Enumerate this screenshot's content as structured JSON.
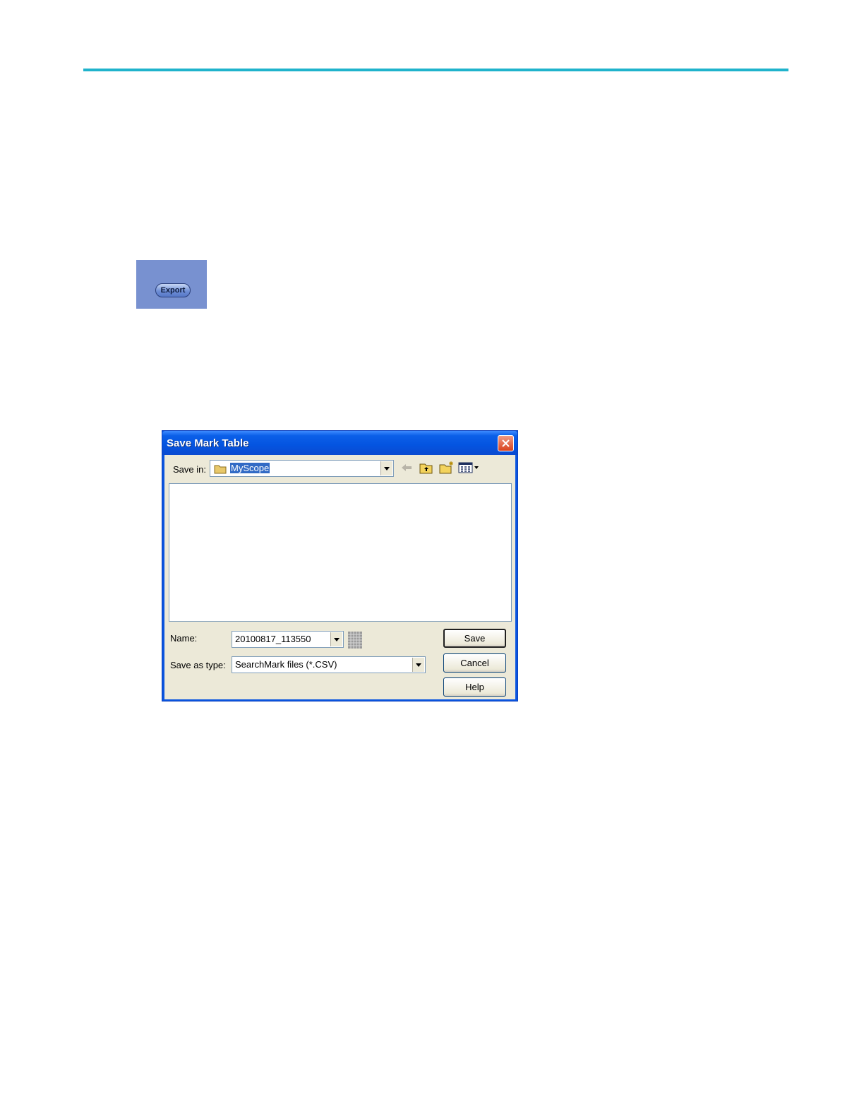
{
  "export_button": {
    "label": "Export"
  },
  "dialog": {
    "title": "Save Mark Table",
    "save_in_label": "Save in:",
    "save_in_value": "MyScope",
    "name_label": "Name:",
    "name_value": "20100817_113550",
    "save_as_type_label": "Save as type:",
    "save_as_type_value": "SearchMark files (*.CSV)",
    "buttons": {
      "save": "Save",
      "cancel": "Cancel",
      "help": "Help"
    },
    "toolbar_icons": [
      "back-arrow-icon",
      "up-folder-icon",
      "new-folder-icon",
      "view-menu-icon"
    ]
  },
  "colors": {
    "accent_rule": "#20b3cc",
    "title_bar": "#0a55e0",
    "close_button": "#d9431e",
    "dialog_body": "#ece9d8"
  }
}
